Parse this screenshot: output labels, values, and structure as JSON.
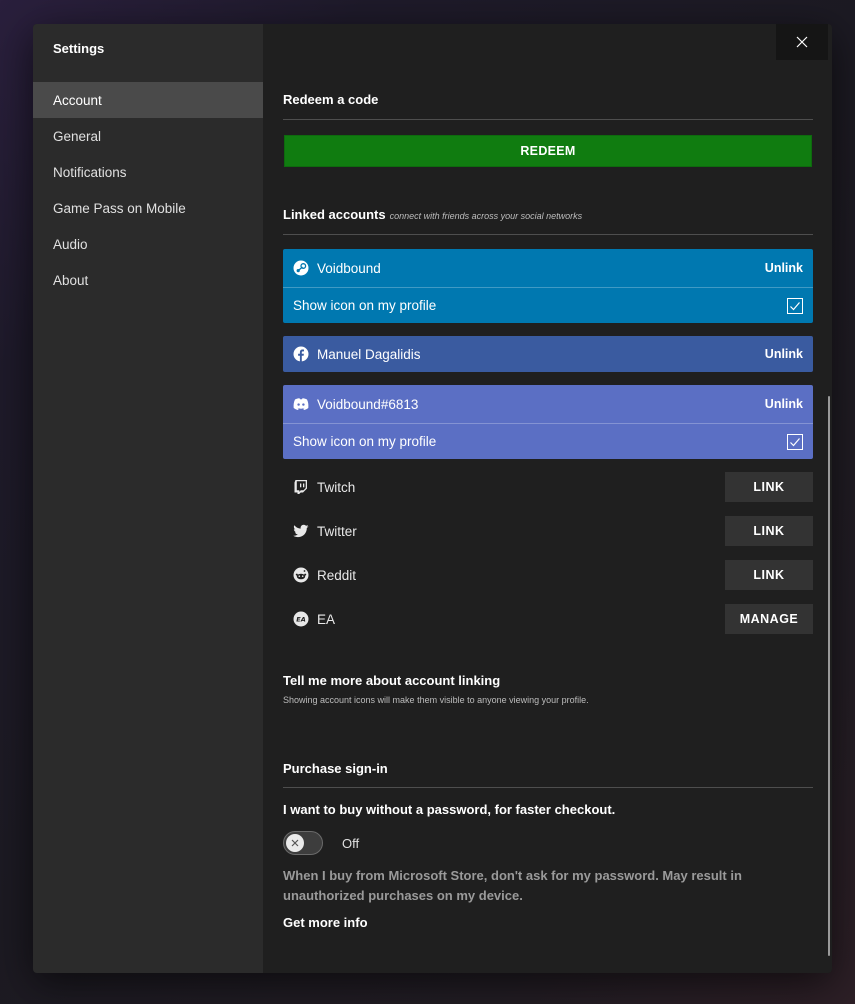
{
  "sidebar": {
    "title": "Settings",
    "items": [
      {
        "label": "Account"
      },
      {
        "label": "General"
      },
      {
        "label": "Notifications"
      },
      {
        "label": "Game Pass on Mobile"
      },
      {
        "label": "Audio"
      },
      {
        "label": "About"
      }
    ]
  },
  "redeem": {
    "title": "Redeem a code",
    "button_label": "REDEEM"
  },
  "linked": {
    "title": "Linked accounts",
    "subtitle": "connect with friends across your social networks",
    "steam": {
      "name": "Voidbound",
      "action": "Unlink",
      "show_icon_label": "Show icon on my profile",
      "checked": true,
      "icon": "steam-icon",
      "color": "#0078b0"
    },
    "facebook": {
      "name": "Manuel Dagalidis",
      "action": "Unlink",
      "icon": "facebook-icon",
      "color": "#3a5ba0"
    },
    "discord": {
      "name": "Voidbound#6813",
      "action": "Unlink",
      "show_icon_label": "Show icon on my profile",
      "checked": true,
      "icon": "discord-icon",
      "color": "#5b6fc4"
    },
    "twitch": {
      "name": "Twitch",
      "action": "LINK",
      "icon": "twitch-icon"
    },
    "twitter": {
      "name": "Twitter",
      "action": "LINK",
      "icon": "twitter-icon"
    },
    "reddit": {
      "name": "Reddit",
      "action": "LINK",
      "icon": "reddit-icon"
    },
    "ea": {
      "name": "EA",
      "action": "MANAGE",
      "icon": "ea-icon"
    }
  },
  "more_info": {
    "title": "Tell me more about account linking",
    "note": "Showing account icons will make them visible to anyone viewing your profile."
  },
  "purchase": {
    "title": "Purchase sign-in",
    "question": "I want to buy without a password, for faster checkout.",
    "toggle_state": "Off",
    "description": "When I buy from Microsoft Store, don't ask for my password. May result in unauthorized purchases on my device.",
    "get_more_info": "Get more info"
  },
  "colors": {
    "accent_green": "#107c10"
  }
}
